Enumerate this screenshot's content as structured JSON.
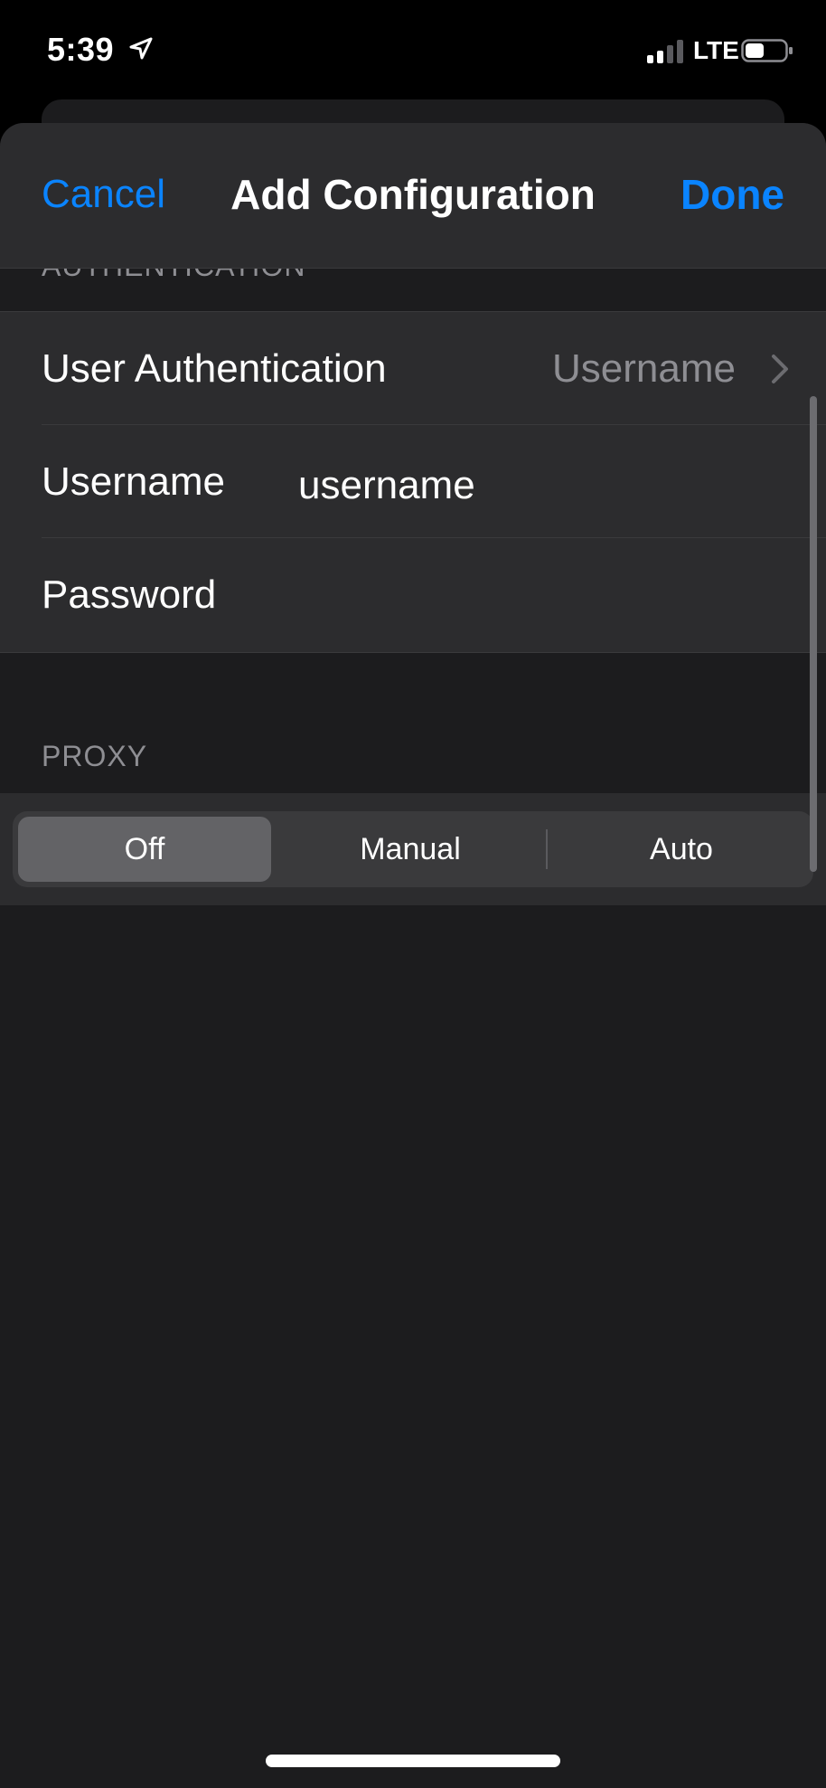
{
  "status_bar": {
    "time": "5:39",
    "carrier": "LTE",
    "location_icon": "location-arrow-icon",
    "signal_icon": "cellular-signal-icon",
    "battery_icon": "battery-icon"
  },
  "navbar": {
    "cancel_label": "Cancel",
    "title": "Add Configuration",
    "done_label": "Done",
    "accent_color": "#0a84ff"
  },
  "authentication": {
    "header": "AUTHENTICATION",
    "rows": [
      {
        "label": "User Authentication",
        "value": "Username"
      },
      {
        "label": "Username",
        "value": "username"
      },
      {
        "label": "Password",
        "value": ""
      }
    ]
  },
  "proxy": {
    "header": "PROXY",
    "options": [
      "Off",
      "Manual",
      "Auto"
    ],
    "selected": "Off"
  }
}
